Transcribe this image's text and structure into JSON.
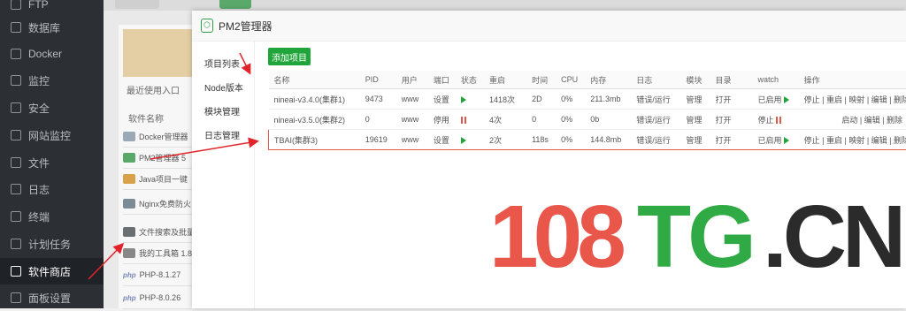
{
  "sidebar": {
    "items": [
      {
        "label": "FTP",
        "icon": "ftp-icon"
      },
      {
        "label": "数据库",
        "icon": "database-icon"
      },
      {
        "label": "Docker",
        "icon": "docker-icon"
      },
      {
        "label": "监控",
        "icon": "monitor-icon"
      },
      {
        "label": "安全",
        "icon": "shield-icon"
      },
      {
        "label": "网站监控",
        "icon": "site-monitor-icon"
      },
      {
        "label": "文件",
        "icon": "folder-icon"
      },
      {
        "label": "日志",
        "icon": "log-icon"
      },
      {
        "label": "终端",
        "icon": "terminal-icon"
      },
      {
        "label": "计划任务",
        "icon": "clock-icon"
      },
      {
        "label": "软件商店",
        "icon": "grid-icon",
        "active": true
      },
      {
        "label": "面板设置",
        "icon": "settings-icon"
      }
    ]
  },
  "background": {
    "recent_label": "最近使用入口",
    "software_name_header": "软件名称",
    "rows": [
      "Docker管理器",
      "PM2管理器 5",
      "Java项目一键",
      "Nginx免费防火",
      "文件搜索及批量",
      "我的工具箱 1.8",
      "PHP-8.1.27",
      "PHP-8.0.26"
    ]
  },
  "modal": {
    "title": "PM2管理器",
    "side": [
      "项目列表",
      "Node版本",
      "模块管理",
      "日志管理"
    ],
    "add_button": "添加项目",
    "columns": [
      "名称",
      "PID",
      "用户",
      "端口",
      "状态",
      "重启",
      "时间",
      "CPU",
      "内存",
      "日志",
      "模块",
      "目录",
      "watch",
      "操作"
    ],
    "rows": [
      {
        "name": "nineai-v3.4.0(集群1)",
        "pid": "9473",
        "user": "www",
        "port": "设置",
        "restart": "1418次",
        "time": "2D",
        "cpu": "0%",
        "mem": "211.3mb",
        "log": "错误/运行",
        "module": "管理",
        "dir": "打开",
        "watch": "已启用",
        "ops": "停止 | 重启 | 映射 | 编辑 | 删除"
      },
      {
        "name": "nineai-v3.5.0(集群2)",
        "pid": "0",
        "user": "www",
        "port": "停用",
        "restart": "4次",
        "time": "0",
        "cpu": "0%",
        "mem": "0b",
        "log": "错误/运行",
        "module": "管理",
        "dir": "打开",
        "watch": "停止",
        "ops": "启动 | 编辑 | 删除"
      },
      {
        "name": "TBAI(集群3)",
        "pid": "19619",
        "user": "www",
        "port": "设置",
        "restart": "2次",
        "time": "118s",
        "cpu": "0%",
        "mem": "144.8mb",
        "log": "错误/运行",
        "module": "管理",
        "dir": "打开",
        "watch": "已启用",
        "ops": "停止 | 重启 | 映射 | 编辑 | 删除"
      }
    ]
  },
  "watermark": {
    "num": "108",
    "tg": "TG",
    "cn": ".CN"
  },
  "colors": {
    "accent": "#20a53a",
    "danger": "#e2574c",
    "sidebar": "#2c3034"
  }
}
